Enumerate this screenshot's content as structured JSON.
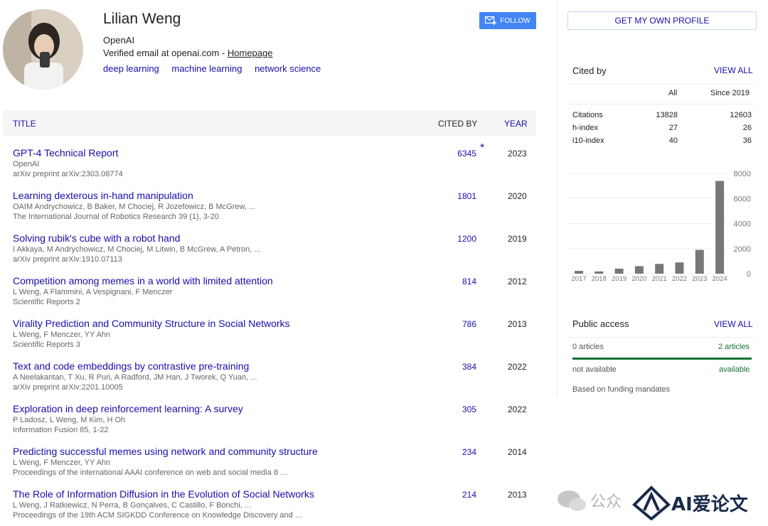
{
  "profile": {
    "name": "Lilian Weng",
    "affiliation": "OpenAI",
    "email_text": "Verified email at openai.com - ",
    "homepage_label": "Homepage",
    "interests": [
      "deep learning",
      "machine learning",
      "network science"
    ],
    "follow_label": "FOLLOW"
  },
  "table": {
    "col_title": "TITLE",
    "col_cited": "CITED BY",
    "col_year": "YEAR",
    "rows": [
      {
        "title": "GPT-4 Technical Report",
        "authors": "OpenAI",
        "venue": "arXiv preprint arXiv:2303.08774",
        "cited": "6345",
        "star": "*",
        "year": "2023"
      },
      {
        "title": "Learning dexterous in-hand manipulation",
        "authors": "OAIM Andrychowicz, B Baker, M Chociej, R Jozefowicz, B McGrew, ...",
        "venue": "The International Journal of Robotics Research 39 (1), 3-20",
        "cited": "1801",
        "star": "",
        "year": "2020"
      },
      {
        "title": "Solving rubik's cube with a robot hand",
        "authors": "I Akkaya, M Andrychowicz, M Chociej, M Litwin, B McGrew, A Petron, ...",
        "venue": "arXiv preprint arXiv:1910.07113",
        "cited": "1200",
        "star": "",
        "year": "2019"
      },
      {
        "title": "Competition among memes in a world with limited attention",
        "authors": "L Weng, A Flammini, A Vespignani, F Menczer",
        "venue": "Scientific Reports 2",
        "cited": "814",
        "star": "",
        "year": "2012"
      },
      {
        "title": "Virality Prediction and Community Structure in Social Networks",
        "authors": "L Weng, F Menczer, YY Ahn",
        "venue": "Scientific Reports 3",
        "cited": "786",
        "star": "",
        "year": "2013"
      },
      {
        "title": "Text and code embeddings by contrastive pre-training",
        "authors": "A Neelakantan, T Xu, R Puri, A Radford, JM Han, J Tworek, Q Yuan, ...",
        "venue": "arXiv preprint arXiv:2201.10005",
        "cited": "384",
        "star": "",
        "year": "2022"
      },
      {
        "title": "Exploration in deep reinforcement learning: A survey",
        "authors": "P Ladosz, L Weng, M Kim, H Oh",
        "venue": "Information Fusion 85, 1-22",
        "cited": "305",
        "star": "",
        "year": "2022"
      },
      {
        "title": "Predicting successful memes using network and community structure",
        "authors": "L Weng, F Menczer, YY Ahn",
        "venue": "Proceedings of the international AAAI conference on web and social media 8 …",
        "cited": "234",
        "star": "",
        "year": "2014"
      },
      {
        "title": "The Role of Information Diffusion in the Evolution of Social Networks",
        "authors": "L Weng, J Ratkiewicz, N Perra, B Gonçalves, C Castillo, F Bonchi, ...",
        "venue": "Proceedings of the 19th ACM SIGKDD Conference on Knowledge Discovery and …",
        "cited": "214",
        "star": "",
        "year": "2013"
      }
    ]
  },
  "sidebar": {
    "get_profile_label": "GET MY OWN PROFILE",
    "cited_by": {
      "title": "Cited by",
      "view_all": "VIEW ALL",
      "col_all": "All",
      "col_since": "Since 2019",
      "stats": [
        {
          "label": "Citations",
          "all": "13828",
          "since": "12603"
        },
        {
          "label": "h-index",
          "all": "27",
          "since": "26"
        },
        {
          "label": "i10-index",
          "all": "40",
          "since": "36"
        }
      ]
    },
    "public_access": {
      "title": "Public access",
      "view_all": "VIEW ALL",
      "left_count": "0 articles",
      "right_count": "2 articles",
      "left_status": "not available",
      "right_status": "available",
      "available_fraction": 1.0,
      "note": "Based on funding mandates"
    }
  },
  "chart_data": {
    "type": "bar",
    "categories": [
      "2017",
      "2018",
      "2019",
      "2020",
      "2021",
      "2022",
      "2023",
      "2024"
    ],
    "values": [
      220,
      180,
      400,
      600,
      780,
      900,
      1900,
      7400
    ],
    "ylim": [
      0,
      8000
    ],
    "yticks": [
      "0",
      "2000",
      "4000",
      "6000",
      "8000"
    ],
    "bar_color": "#777777"
  },
  "watermark": {
    "text_a": "公众",
    "text_b": "AI爱论文"
  },
  "colors": {
    "link": "#1a0dab",
    "follow": "#4285f4",
    "available": "#137333"
  }
}
